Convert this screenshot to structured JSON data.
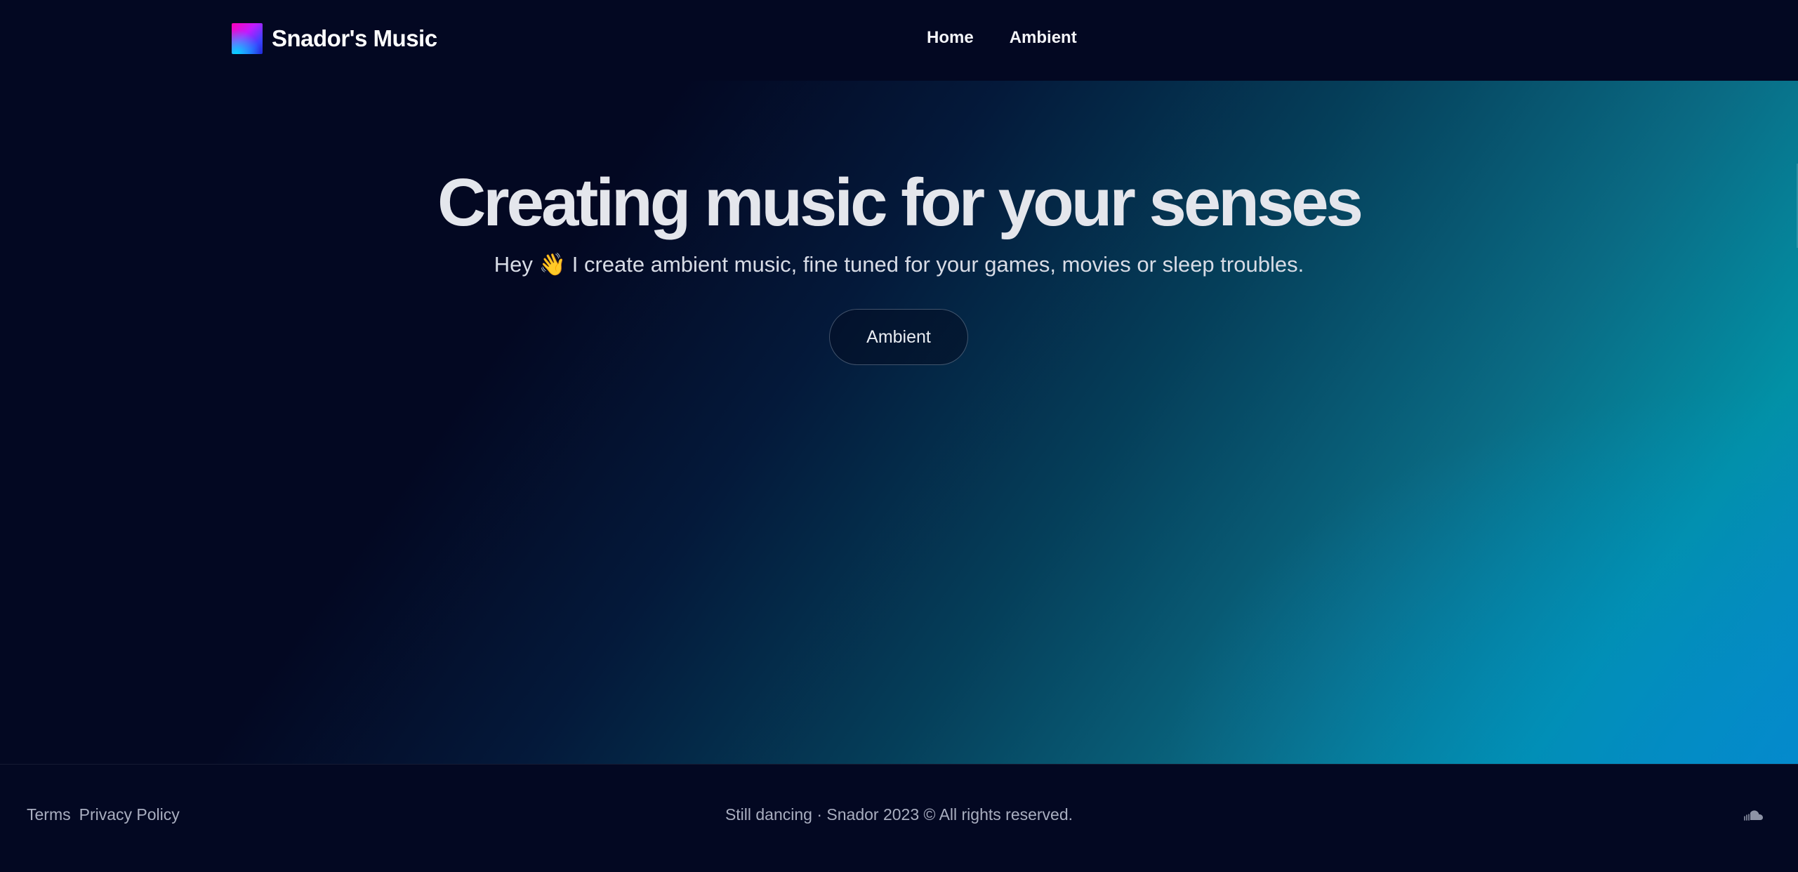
{
  "header": {
    "brand_name": "Snador's Music",
    "nav": [
      {
        "label": "Home"
      },
      {
        "label": "Ambient"
      }
    ]
  },
  "hero": {
    "title": "Creating music for your senses",
    "subtitle": "Hey 👋 I create ambient music, fine tuned for your games, movies or sleep troubles.",
    "cta_label": "Ambient"
  },
  "footer": {
    "links": [
      {
        "label": "Terms"
      },
      {
        "label": "Privacy Policy"
      }
    ],
    "copyright": "Still dancing · Snador 2023 © All rights reserved.",
    "social_icon": "soundcloud-icon"
  },
  "colors": {
    "background": "#030822",
    "gradient_mid": "#053f5a",
    "gradient_accent": "#0291a6",
    "text": "#e4e6ec",
    "muted_text": "#a9aec0"
  }
}
